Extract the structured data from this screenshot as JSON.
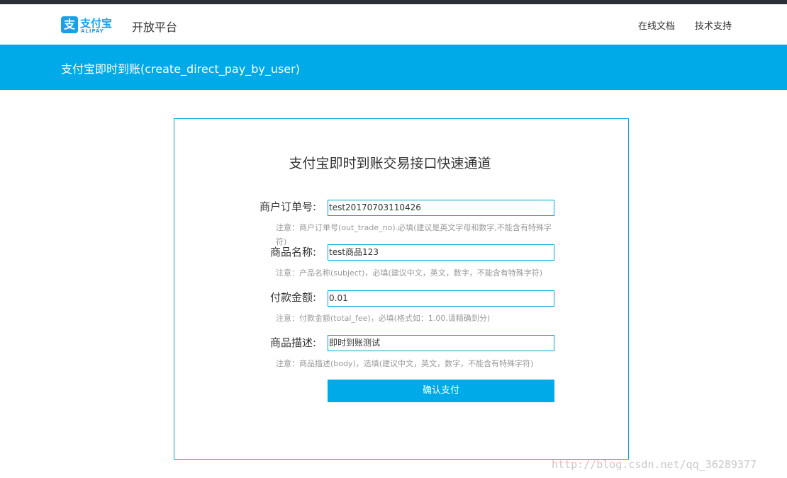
{
  "header": {
    "logo_cn": "支付宝",
    "logo_en": "ALIPAY",
    "platform_title": "开放平台",
    "nav": {
      "docs": "在线文档",
      "support": "技术支持"
    }
  },
  "banner": {
    "title": "支付宝即时到账(create_direct_pay_by_user)"
  },
  "form": {
    "title": "支付宝即时到账交易接口快速通道",
    "fields": [
      {
        "label": "商户订单号:",
        "value": "test20170703110426",
        "note": "注意：商户订单号(out_trade_no).必填(建议是英文字母和数字,不能含有特殊字符)"
      },
      {
        "label": "商品名称:",
        "value": "test商品123",
        "note": "注意：产品名称(subject)，必填(建议中文，英文，数字，不能含有特殊字符)"
      },
      {
        "label": "付款金额:",
        "value": "0.01",
        "note": "注意：付款金额(total_fee)，必填(格式如：1.00,请精确到分)"
      },
      {
        "label": "商品描述:",
        "value": "即时到账测试",
        "note": "注意：商品描述(body)，选填(建议中文，英文，数字，不能含有特殊字符)"
      }
    ],
    "submit_label": "确认支付"
  },
  "watermark": "http://blog.csdn.net/qq_36289377",
  "colors": {
    "brand": "#00a9e8",
    "border": "#00a3d9",
    "topbar": "#2b2f36",
    "note": "#999999"
  }
}
